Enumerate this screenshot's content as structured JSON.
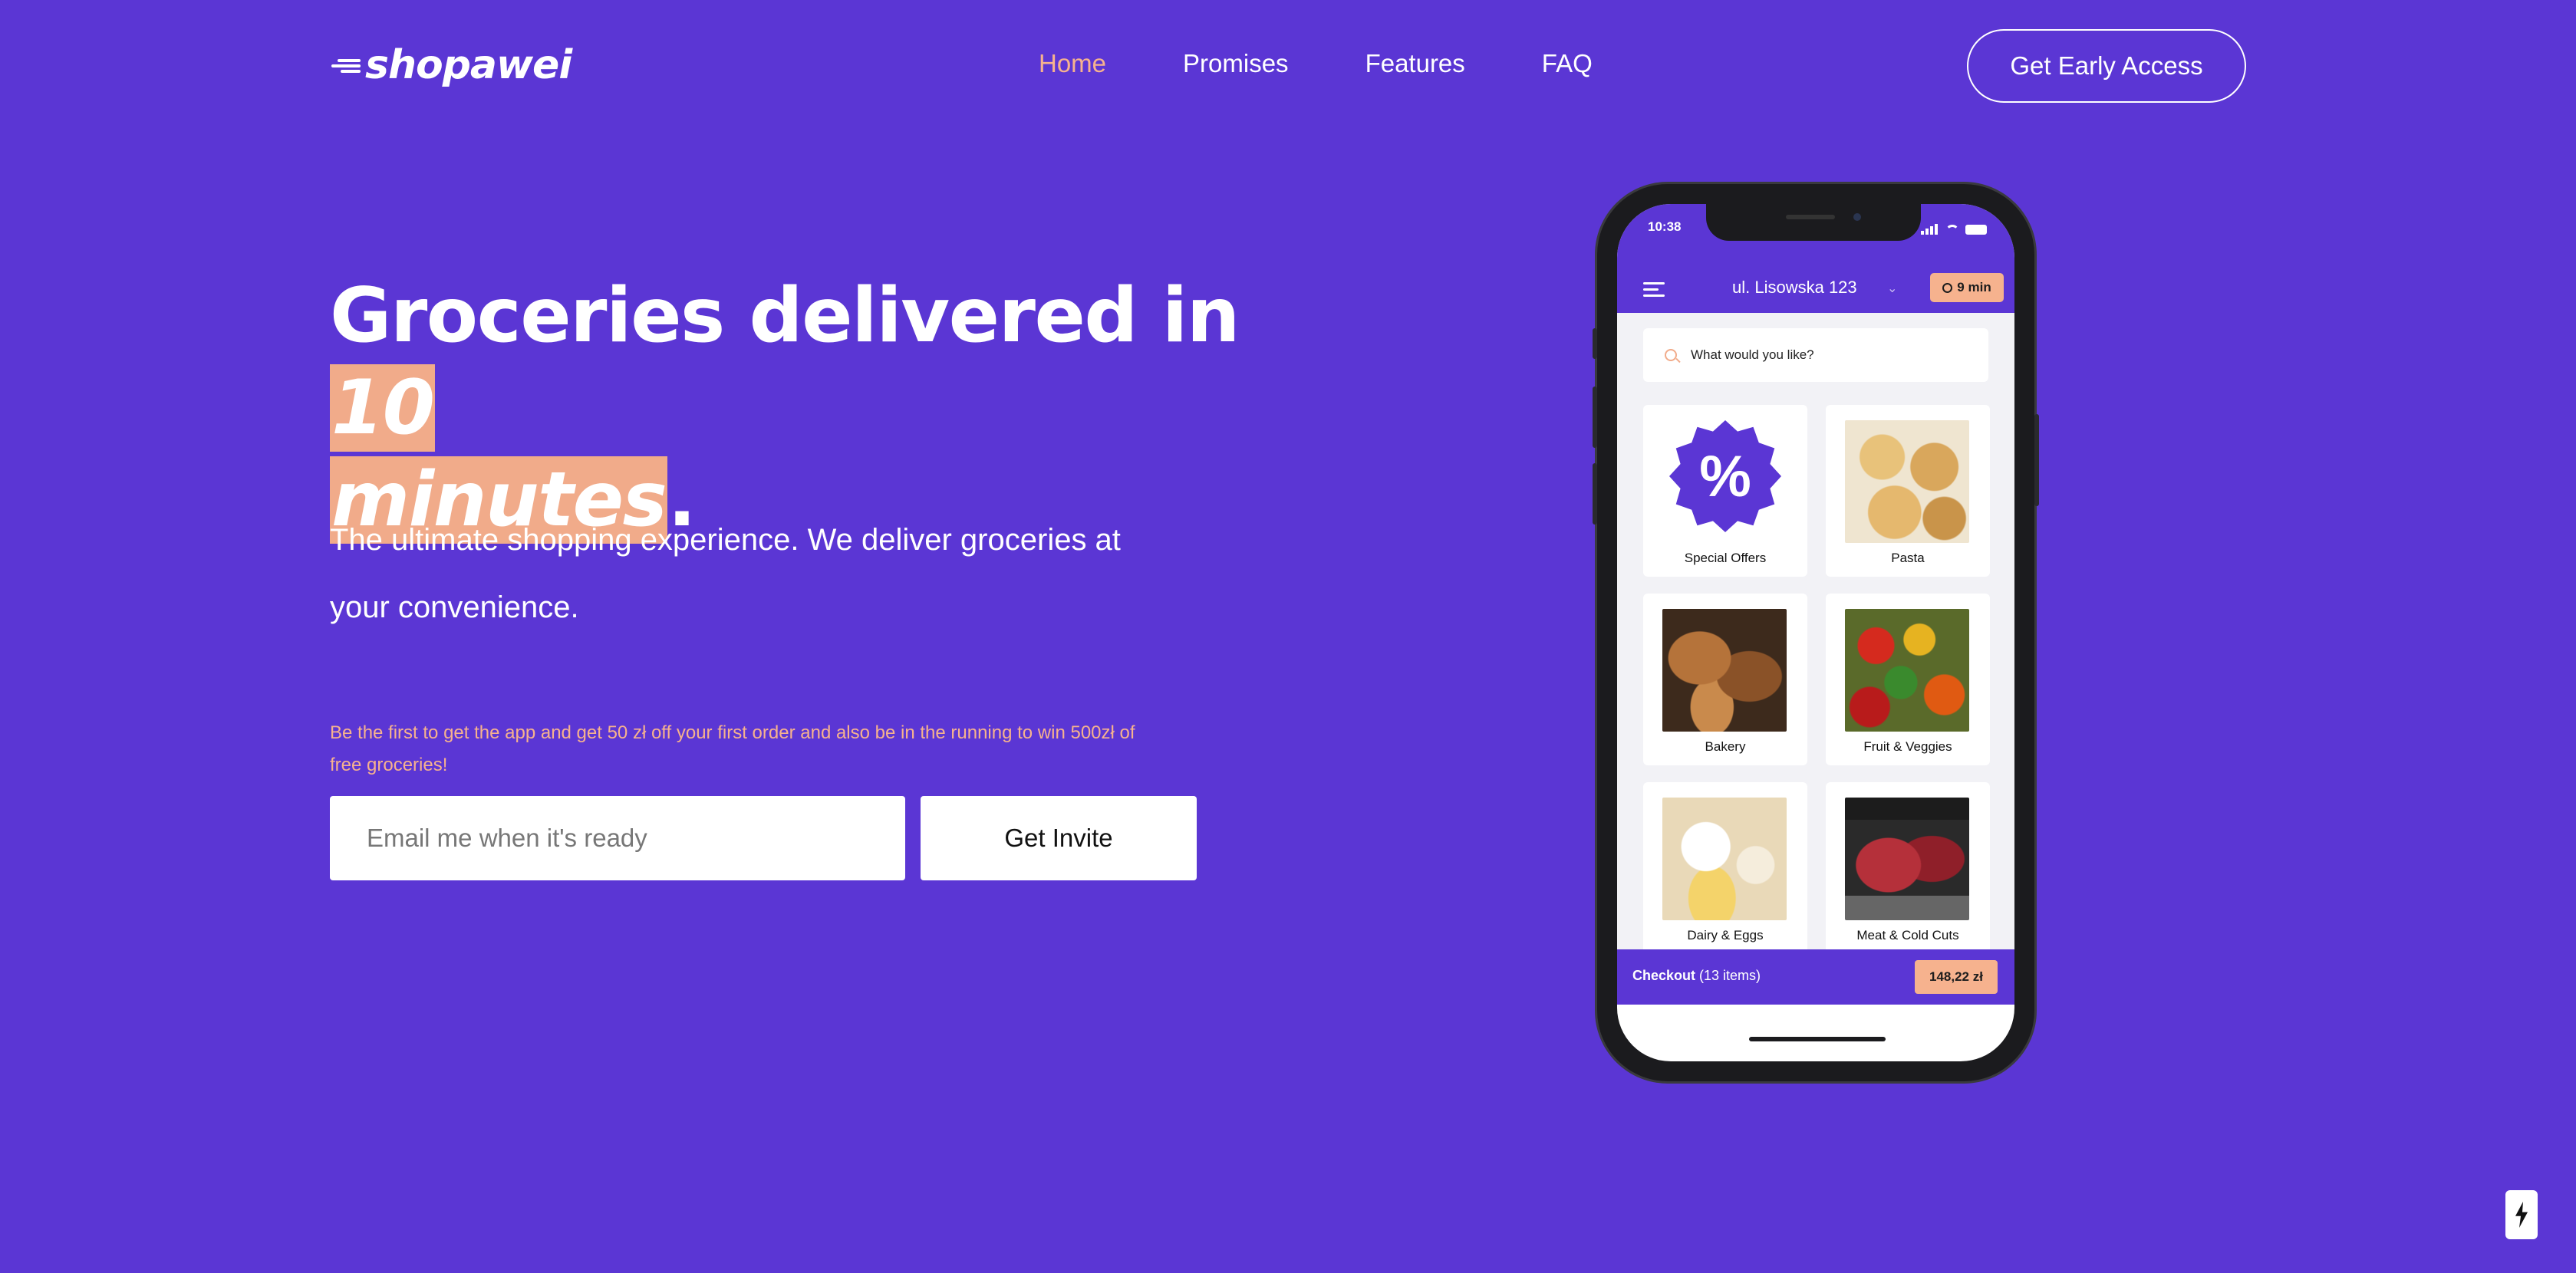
{
  "nav": {
    "logo_text": "shopawei",
    "links": [
      "Home",
      "Promises",
      "Features",
      "FAQ"
    ],
    "active_link": "Home",
    "cta": "Get Early Access"
  },
  "hero": {
    "title_part1": "Groceries delivered in ",
    "title_highlight1": "10",
    "title_highlight2": "minutes",
    "title_end": ".",
    "subtitle": "The ultimate shopping experience. We deliver groceries at your convenience.",
    "promo": "Be the first to get the app and get 50 zł off your first order and also be in the running to win 500zł of free groceries!",
    "email_placeholder": "Email me when it's ready",
    "invite_button": "Get Invite"
  },
  "phone": {
    "status_time": "10:38",
    "address": "ul. Lisowska 123",
    "eta": "9 min",
    "search_placeholder": "What would you like?",
    "categories": [
      {
        "label": "Special Offers",
        "icon": "percent-badge-icon"
      },
      {
        "label": "Pasta"
      },
      {
        "label": "Bakery"
      },
      {
        "label": "Fruit & Veggies"
      },
      {
        "label": "Dairy & Eggs"
      },
      {
        "label": "Meat & Cold Cuts"
      }
    ],
    "offer_symbol": "%",
    "checkout_label": "Checkout",
    "checkout_count": "(13 items)",
    "checkout_price": "148,22 zł"
  },
  "colors": {
    "background": "#5b36d4",
    "accent": "#f6b28e",
    "highlight": "#f1ab8a"
  }
}
